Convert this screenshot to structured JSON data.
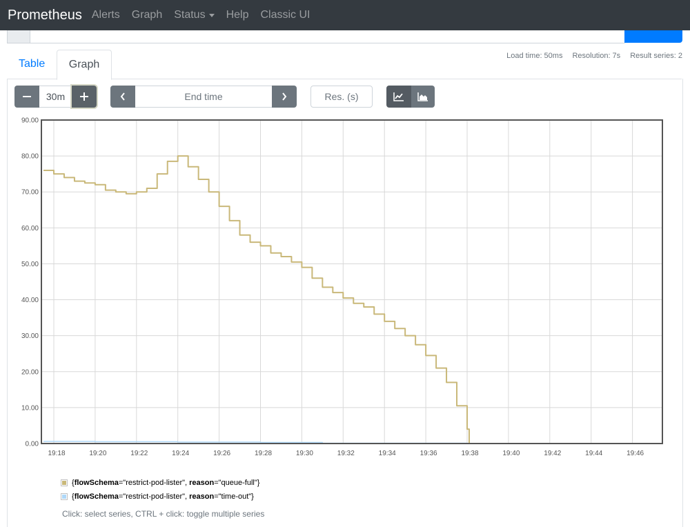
{
  "navbar": {
    "brand": "Prometheus",
    "items": [
      "Alerts",
      "Graph",
      "Status",
      "Help",
      "Classic UI"
    ]
  },
  "tabs": {
    "table": "Table",
    "graph": "Graph"
  },
  "stats": {
    "load_time": "Load time: 50ms",
    "resolution": "Resolution: 7s",
    "result_series": "Result series: 2"
  },
  "controls": {
    "range": "30m",
    "end_time_placeholder": "End time",
    "res_placeholder": "Res. (s)"
  },
  "colors": {
    "series_queue_full": "#c9b879",
    "series_time_out": "#afd8f8",
    "navbar": "#343a40",
    "accent": "#007bff"
  },
  "chart_data": {
    "type": "line",
    "ylim": [
      0,
      90
    ],
    "y_ticks": [
      "0.00",
      "10.00",
      "20.00",
      "30.00",
      "40.00",
      "50.00",
      "60.00",
      "70.00",
      "80.00",
      "90.00"
    ],
    "x_ticks": [
      "19:18",
      "19:20",
      "19:22",
      "19:24",
      "19:26",
      "19:28",
      "19:30",
      "19:32",
      "19:34",
      "19:36",
      "19:38",
      "19:40",
      "19:42",
      "19:44",
      "19:46"
    ],
    "grid": true,
    "series": [
      {
        "name": "queue-full",
        "x": [
          "19:17.5",
          "19:18",
          "19:18.5",
          "19:19",
          "19:19.5",
          "19:20",
          "19:20.5",
          "19:21",
          "19:21.5",
          "19:22",
          "19:22.5",
          "19:23",
          "19:23.5",
          "19:24",
          "19:24.5",
          "19:25",
          "19:25.5",
          "19:26",
          "19:26.5",
          "19:27",
          "19:27.5",
          "19:28",
          "19:28.5",
          "19:29",
          "19:29.5",
          "19:30",
          "19:30.5",
          "19:31",
          "19:31.5",
          "19:32",
          "19:32.5",
          "19:33",
          "19:33.5",
          "19:34",
          "19:34.5",
          "19:35",
          "19:35.5",
          "19:36",
          "19:36.5",
          "19:37",
          "19:37.5",
          "19:38",
          "19:38.1",
          "19:39",
          "19:40",
          "19:41",
          "19:42",
          "19:43",
          "19:44",
          "19:45",
          "19:46",
          "19:47"
        ],
        "values": [
          76,
          75,
          74,
          73,
          72.5,
          72,
          70.5,
          70,
          69.5,
          70,
          71,
          75,
          78.5,
          80,
          77,
          73.5,
          70,
          66,
          62,
          58,
          56,
          55,
          53,
          52,
          50.5,
          49,
          46,
          43.5,
          42,
          40.5,
          39,
          38,
          36,
          34,
          32,
          30,
          27.5,
          24.5,
          21,
          17,
          10.5,
          4,
          0,
          0,
          0,
          0,
          0,
          0,
          0,
          0,
          0,
          0
        ]
      },
      {
        "name": "time-out",
        "x": [
          "19:17.5",
          "19:20",
          "19:24",
          "19:28",
          "19:31",
          "19:38",
          "19:47"
        ],
        "values": [
          0.6,
          0.5,
          0.4,
          0.3,
          0.1,
          0,
          0
        ]
      }
    ]
  },
  "legend": [
    {
      "prefix": "{",
      "k1": "flowSchema",
      "v1": "=\"restrict-pod-lister\", ",
      "k2": "reason",
      "v2": "=\"queue-full\"}"
    },
    {
      "prefix": "{",
      "k1": "flowSchema",
      "v1": "=\"restrict-pod-lister\", ",
      "k2": "reason",
      "v2": "=\"time-out\"}"
    }
  ],
  "hint": "Click: select series, CTRL + click: toggle multiple series"
}
